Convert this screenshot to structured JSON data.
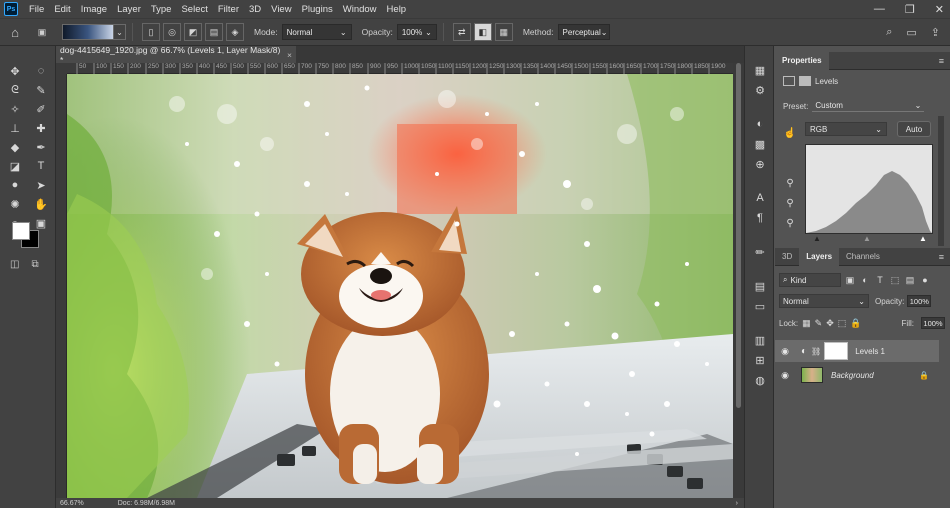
{
  "menubar": {
    "app_logo": "Ps",
    "items": [
      "File",
      "Edit",
      "Image",
      "Layer",
      "Type",
      "Select",
      "Filter",
      "3D",
      "View",
      "Plugins",
      "Window",
      "Help"
    ]
  },
  "options": {
    "mode_label": "Mode:",
    "mode_value": "Normal",
    "opacity_label": "Opacity:",
    "opacity_value": "100%",
    "method_label": "Method:",
    "method_value": "Perceptual"
  },
  "document": {
    "tab_title": "dog-4415649_1920.jpg @ 66.7% (Levels 1, Layer Mask/8) *",
    "close": "×",
    "ruler_marks": [
      "50",
      "100",
      "150",
      "200",
      "250",
      "300",
      "350",
      "400",
      "450",
      "500",
      "550",
      "600",
      "650",
      "700",
      "750",
      "800",
      "850",
      "900",
      "950",
      "1000",
      "1050",
      "1100",
      "1150",
      "1200",
      "1250",
      "1300",
      "1350",
      "1400",
      "1450",
      "1500",
      "1550",
      "1600",
      "1650",
      "1700",
      "1750",
      "1800",
      "1850",
      "1900"
    ]
  },
  "status": {
    "zoom": "66.67%",
    "doc": "Doc: 6.98M/6.98M"
  },
  "properties": {
    "title": "Properties",
    "adjustment": "Levels",
    "preset_label": "Preset:",
    "preset_value": "Custom",
    "channel": "RGB",
    "auto_label": "Auto"
  },
  "layers_panel": {
    "tabs": [
      "3D",
      "Layers",
      "Channels"
    ],
    "kind_value": "Kind",
    "blend_mode": "Normal",
    "opacity_label": "Opacity:",
    "opacity_value": "100%",
    "lock_label": "Lock:",
    "fill_label": "Fill:",
    "fill_value": "100%",
    "layers": [
      {
        "name": "Levels 1",
        "selected": true
      },
      {
        "name": "Background",
        "selected": false
      }
    ]
  },
  "colors": {
    "accent": "#31a8ff",
    "foreground": "#ffffff",
    "background": "#000000"
  }
}
